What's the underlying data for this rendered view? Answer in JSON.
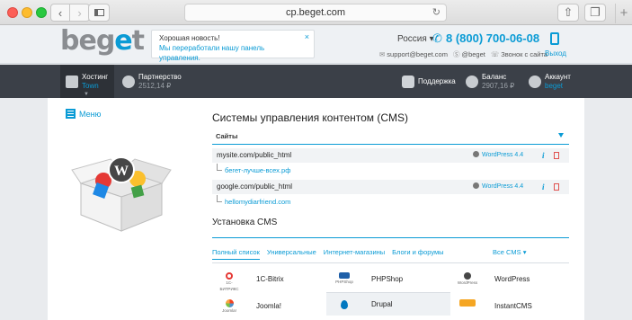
{
  "browser": {
    "url": "cp.beget.com"
  },
  "header": {
    "logo_main": "beg",
    "logo_accent": "e",
    "logo_end": "t",
    "news_title": "Хорошая новость!",
    "news_message": "Мы переработали нашу панель управления.",
    "news_close": "×",
    "country": "Россия ▾",
    "phone": "8 (800) 700-06-08",
    "email": "support@beget.com",
    "skype": "@beget",
    "callback": "Звонок с сайта",
    "exit": "Выход"
  },
  "navbar": {
    "hosting_label": "Хостинг",
    "hosting_plan": "Town",
    "partner_label": "Партнерство",
    "partner_value": "2512,14 ₽",
    "support_label": "Поддержка",
    "balance_label": "Баланс",
    "balance_value": "2907,16 ₽",
    "account_label": "Аккаунт",
    "account_value": "beget"
  },
  "main": {
    "menu_label": "Меню",
    "page_title": "Системы управления контентом (CMS)",
    "sites_header": "Сайты",
    "sites": [
      {
        "path": "mysite.com/public_html",
        "cms": "WordPress 4.4",
        "domain": "бегет-лучше-всех.рф"
      },
      {
        "path": "google.com/public_html",
        "cms": "WordPress 4.4",
        "domain": "hellomydiarfriend.com"
      }
    ],
    "info_glyph": "i",
    "install_title": "Установка CMS",
    "categories": [
      "Полный список",
      "Универсальные",
      "Интернет-магазины",
      "Блоги и форумы"
    ],
    "all_cms": "Все CMS ▾",
    "cms_list": [
      {
        "name": "1C-Bitrix",
        "logo": "1C-БИТРИКС"
      },
      {
        "name": "PHPShop",
        "logo": "PHPShop"
      },
      {
        "name": "WordPress",
        "logo": "WordPress"
      },
      {
        "name": "Joomla!",
        "logo": "Joomla!"
      },
      {
        "name": "Drupal",
        "logo": "Drupal"
      },
      {
        "name": "InstantCMS",
        "logo": "InstantCMS"
      }
    ]
  },
  "colors": {
    "accent": "#0a9bd5",
    "navbar": "#3b4048",
    "danger": "#e0514f"
  }
}
